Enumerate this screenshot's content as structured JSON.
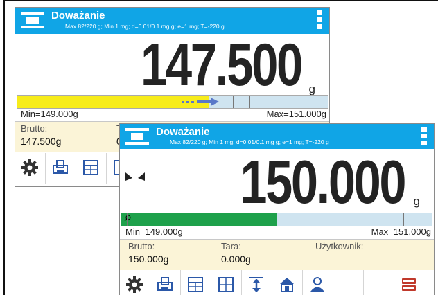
{
  "back": {
    "title": "Doważanie",
    "subtitle": "Max 82/220 g; Min 1 mg; d=0.01/0.1 mg g; e=1 mg; T=-220 g",
    "reading": "147.500",
    "unit": "g",
    "min_label": "Min=149.000g",
    "max_label": "Max=151.000g",
    "gauge_level": 0.62,
    "info": [
      {
        "label": "Brutto:",
        "value": "147.500g"
      },
      {
        "label": "T",
        "value": "0"
      }
    ],
    "toolbar": [
      "gear-icon",
      "print-icon",
      "calc-icon",
      "scale-icon"
    ]
  },
  "front": {
    "title": "Doważanie",
    "subtitle": "Max 82/220 g; Min 1 mg; d=0.01/0.1 mg g; e=1 mg; T=-220 g",
    "reading": "150.000",
    "unit": "g",
    "min_label": "Min=149.000g",
    "max_label": "Max=151.000g",
    "gauge_level": 0.5,
    "info": [
      {
        "label": "Brutto:",
        "value": "150.000g"
      },
      {
        "label": "Tara:",
        "value": "0.000g"
      },
      {
        "label": "Użytkownik:",
        "value": ""
      }
    ],
    "toolbar": [
      "gear-icon",
      "print-icon",
      "calc-icon",
      "calc-alt-icon",
      "tare-icon",
      "home-icon",
      "user-icon",
      "empty",
      "empty",
      "database-icon"
    ]
  },
  "colors": {
    "titlebar": "#10a5e6",
    "gauge_yellow": "#f7ec1a",
    "gauge_green": "#1ea14b",
    "info_bg": "#fbf4d7"
  }
}
